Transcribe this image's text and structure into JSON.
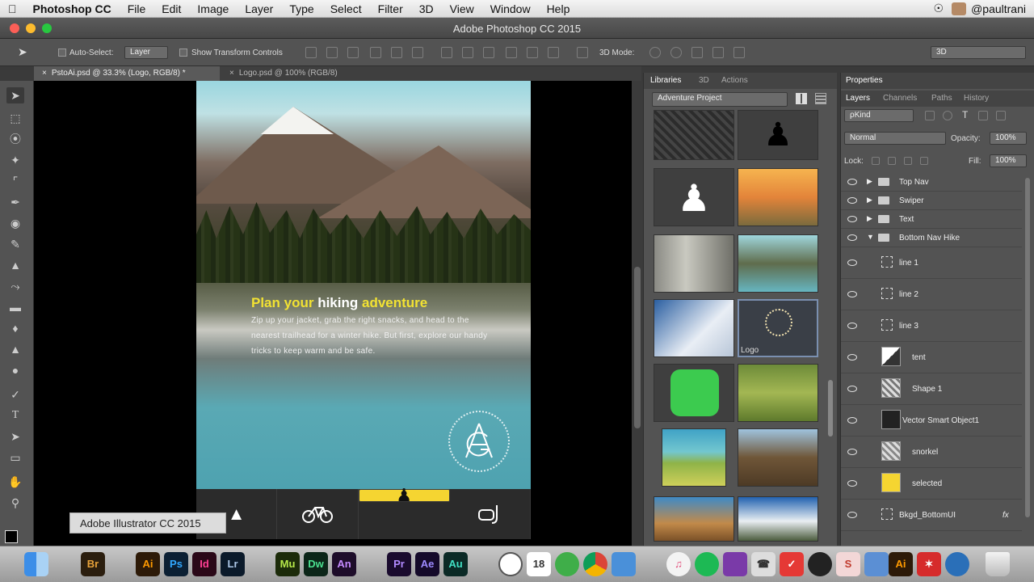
{
  "menubar": {
    "apple_icon": "apple-icon",
    "app_name": "Photoshop CC",
    "items": [
      "File",
      "Edit",
      "Image",
      "Layer",
      "Type",
      "Select",
      "Filter",
      "3D",
      "View",
      "Window",
      "Help"
    ],
    "user": "@paultrani"
  },
  "window": {
    "title": "Adobe Photoshop CC 2015"
  },
  "options_bar": {
    "auto_select_label": "Auto-Select:",
    "auto_select_value": "Layer",
    "show_transform_label": "Show Transform Controls",
    "mode_3d_label": "3D Mode:",
    "workspace_value": "3D"
  },
  "document_tabs": [
    {
      "label": "PstoAi.psd @ 33.3% (Logo, RGB/8) *",
      "active": true
    },
    {
      "label": "Logo.psd @ 100% (RGB/8)",
      "active": false
    }
  ],
  "document": {
    "headline_part1": "Plan your",
    "headline_part2": "hiking",
    "headline_part3": "adventure",
    "body": "Zip up your jacket, grab the right snacks, and head to the nearest trailhead for a winter hike. But first, explore our handy tricks to keep warm and be safe.",
    "nav_items": [
      "tent-icon",
      "bike-icon",
      "hiker-icon",
      "snorkel-icon"
    ],
    "selected_nav_index": 2,
    "accent": "#f5d531"
  },
  "tooltip": "Adobe Illustrator CC 2015",
  "libraries_panel": {
    "tabs": [
      "Libraries",
      "3D",
      "Actions"
    ],
    "library_name": "Adventure Project",
    "thumbnails": [
      {
        "name": "hike-stamp"
      },
      {
        "name": "hiker-black"
      },
      {
        "name": "hiker-white"
      },
      {
        "name": "sunset-hiker"
      },
      {
        "name": "cabin-interior"
      },
      {
        "name": "mountain-lake"
      },
      {
        "name": "snowy-peaks"
      },
      {
        "name": "logo",
        "label": "Logo"
      },
      {
        "name": "messages-app"
      },
      {
        "name": "moose-field"
      },
      {
        "name": "cabin-field"
      },
      {
        "name": "moose-closeup"
      },
      {
        "name": "moose-sky"
      },
      {
        "name": "mountain-range"
      }
    ]
  },
  "properties_panel": {
    "title": "Properties",
    "tabs": [
      "Layers",
      "Channels",
      "Paths",
      "History"
    ],
    "filter_label": "ρKind",
    "blend_mode": "Normal",
    "opacity_label": "Opacity:",
    "opacity_value": "100%",
    "lock_label": "Lock:",
    "fill_label": "Fill:",
    "fill_value": "100%",
    "layers": [
      {
        "name": "Top Nav",
        "type": "folder"
      },
      {
        "name": "Swiper",
        "type": "folder"
      },
      {
        "name": "Text",
        "type": "folder"
      },
      {
        "name": "Bottom Nav Hike",
        "type": "folder-open"
      },
      {
        "name": "line 1",
        "type": "smart"
      },
      {
        "name": "line 2",
        "type": "smart"
      },
      {
        "name": "line 3",
        "type": "smart"
      },
      {
        "name": "tent",
        "type": "shape"
      },
      {
        "name": "Shape 1",
        "type": "shape"
      },
      {
        "name": "Vector Smart Object1",
        "type": "smart"
      },
      {
        "name": "snorkel",
        "type": "shape"
      },
      {
        "name": "selected",
        "type": "fill"
      },
      {
        "name": "Bkgd_BottomUI",
        "type": "smart",
        "fx": "fx"
      }
    ]
  },
  "dock": [
    {
      "label": "",
      "name": "finder-icon"
    },
    {
      "label": "Br",
      "name": "bridge-icon"
    },
    {
      "label": "Ai",
      "name": "illustrator-icon"
    },
    {
      "label": "Ps",
      "name": "photoshop-icon"
    },
    {
      "label": "Id",
      "name": "indesign-icon"
    },
    {
      "label": "Lr",
      "name": "lightroom-icon"
    },
    {
      "label": "Mu",
      "name": "muse-icon"
    },
    {
      "label": "Dw",
      "name": "dreamweaver-icon"
    },
    {
      "label": "An",
      "name": "animate-icon"
    },
    {
      "label": "Pr",
      "name": "premiere-icon"
    },
    {
      "label": "Ae",
      "name": "aftereffects-icon"
    },
    {
      "label": "Au",
      "name": "audition-icon"
    },
    {
      "label": "",
      "name": "clock-icon"
    },
    {
      "label": "18",
      "name": "calendar-icon"
    },
    {
      "label": "",
      "name": "evernote-icon"
    },
    {
      "label": "",
      "name": "chrome-icon"
    },
    {
      "label": "",
      "name": "keynote-icon"
    },
    {
      "label": "",
      "name": "itunes-icon"
    },
    {
      "label": "",
      "name": "spotify-icon"
    },
    {
      "label": "",
      "name": "podcast-icon"
    },
    {
      "label": "",
      "name": "phone-icon"
    },
    {
      "label": "",
      "name": "tasks-icon"
    },
    {
      "label": "",
      "name": "camera-icon"
    },
    {
      "label": "S",
      "name": "stickies-icon"
    },
    {
      "label": "",
      "name": "folder-icon"
    },
    {
      "label": "Ai",
      "name": "illustrator-open-icon"
    },
    {
      "label": "",
      "name": "pdf-icon"
    },
    {
      "label": "",
      "name": "quicktime-icon"
    },
    {
      "label": "",
      "name": "trash-icon"
    }
  ]
}
